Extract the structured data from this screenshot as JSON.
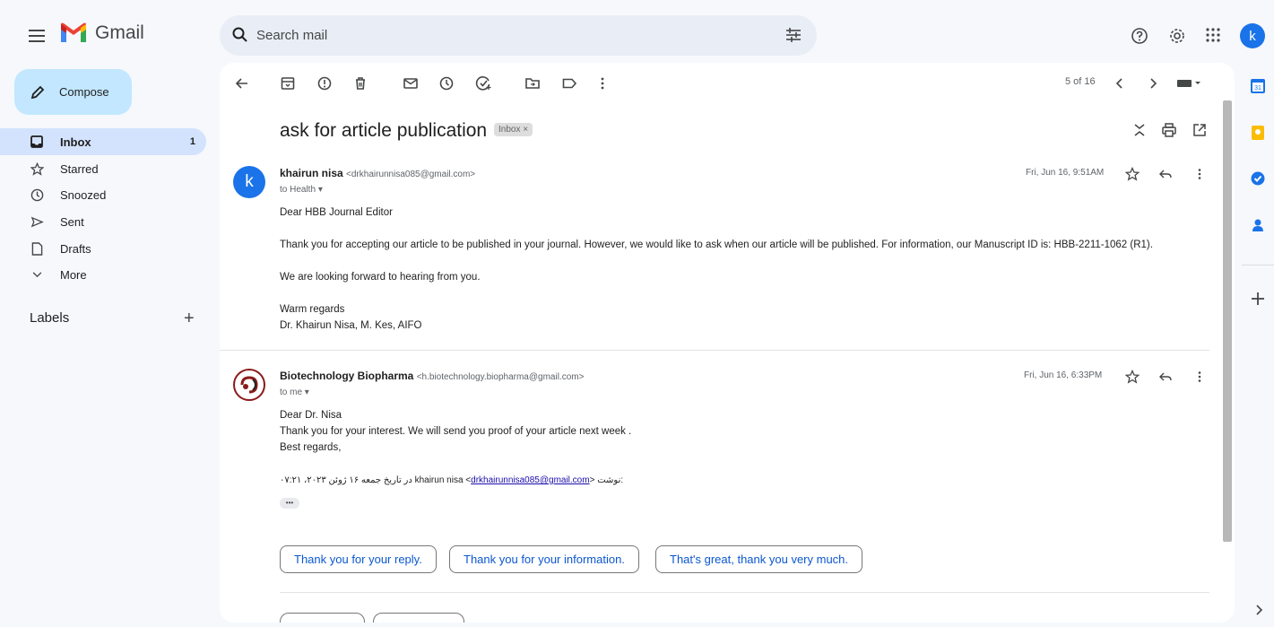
{
  "header": {
    "app_name": "Gmail",
    "search_placeholder": "Search mail",
    "account_initial": "k"
  },
  "nav": {
    "compose_label": "Compose",
    "items": [
      {
        "label": "Inbox",
        "count": "1"
      },
      {
        "label": "Starred"
      },
      {
        "label": "Snoozed"
      },
      {
        "label": "Sent"
      },
      {
        "label": "Drafts"
      },
      {
        "label": "More"
      }
    ],
    "labels_heading": "Labels"
  },
  "thread": {
    "pager": "5 of 16",
    "subject": "ask for article publication",
    "label_chip": "Inbox ×",
    "messages": [
      {
        "avatar": "k",
        "sender_name": "khairun nisa",
        "sender_email": "<drkhairunnisa085@gmail.com>",
        "to": "to Health",
        "date": "Fri, Jun 16, 9:51AM",
        "body": [
          "Dear HBB Journal Editor",
          "Thank you for accepting our article to be published in your journal. However, we would like to ask when our article will be published. For information, our Manuscript ID is: HBB-2211-1062 (R1).",
          "We are looking forward to hearing from you.",
          "Warm regards",
          "Dr. Khairun Nisa, M. Kes, AIFO"
        ]
      },
      {
        "sender_name": "Biotechnology Biopharma",
        "sender_email": "<h.biotechnology.biopharma@gmail.com>",
        "to": "to me",
        "date": "Fri, Jun 16, 6:33PM",
        "body": [
          "Dear Dr. Nisa",
          "Thank you for your interest. We will send you proof of your article next week .",
          "Best regards,"
        ],
        "quote_prefix": "در تاریخ جمعه ۱۶ ژوئن ۲۰۲۳، ۰۷:۲۱ khairun nisa <",
        "quote_link": "drkhairunnisa085@gmail.com",
        "quote_suffix": "> نوشت:",
        "ellipsis": "•••"
      }
    ],
    "smart_replies": [
      "Thank you for your reply.",
      "Thank you for your information.",
      "That's great, thank you very much."
    ]
  },
  "colors": {
    "accent": "#0b57d0",
    "compose_bg": "#c2e7ff",
    "active_nav_bg": "#d3e3fd",
    "avatar_blue": "#1a73e8"
  }
}
